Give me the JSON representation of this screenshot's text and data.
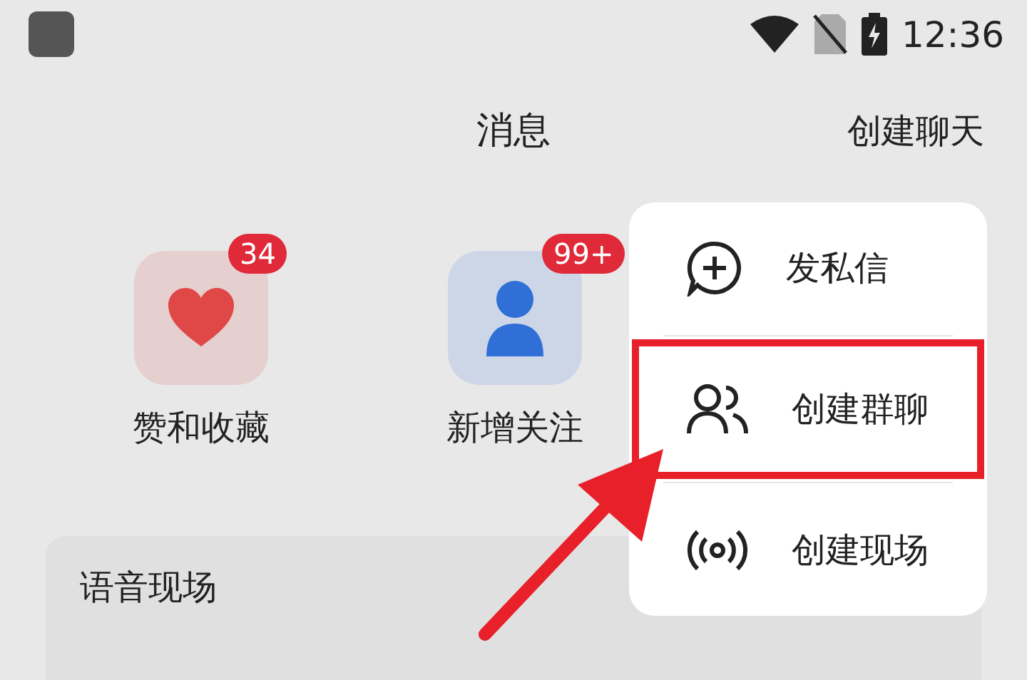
{
  "status_bar": {
    "time": "12:36"
  },
  "header": {
    "title": "消息",
    "action": "创建聊天"
  },
  "shortcuts": [
    {
      "kind": "heart",
      "label": "赞和收藏",
      "badge": "34"
    },
    {
      "kind": "person",
      "label": "新增关注",
      "badge": "99+"
    }
  ],
  "section": {
    "title": "语音现场"
  },
  "menu": {
    "items": [
      {
        "kind": "message",
        "label": "发私信",
        "highlighted": false
      },
      {
        "kind": "group",
        "label": "创建群聊",
        "highlighted": true
      },
      {
        "kind": "broadcast",
        "label": "创建现场",
        "highlighted": false
      }
    ]
  }
}
